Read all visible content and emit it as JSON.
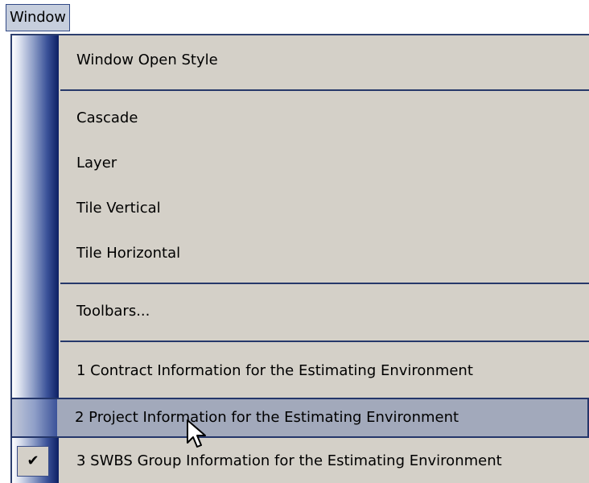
{
  "menubar": {
    "title": "Window"
  },
  "menu": {
    "items": [
      {
        "label": "Window Open Style"
      },
      {
        "label": "Cascade"
      },
      {
        "label": "Layer"
      },
      {
        "label": "Tile Vertical"
      },
      {
        "label": "Tile Horizontal"
      },
      {
        "label": "Toolbars..."
      },
      {
        "label": "1 Contract Information for the Estimating Environment"
      },
      {
        "label": "2 Project Information for the Estimating Environment",
        "highlighted": true
      },
      {
        "label": "3 SWBS Group Information for the Estimating Environment",
        "checked": true,
        "check_glyph": "✔"
      }
    ]
  },
  "colors": {
    "highlight": "#a2a9bb",
    "separator": "#26386a",
    "menu_background": "#d4d0c8"
  }
}
